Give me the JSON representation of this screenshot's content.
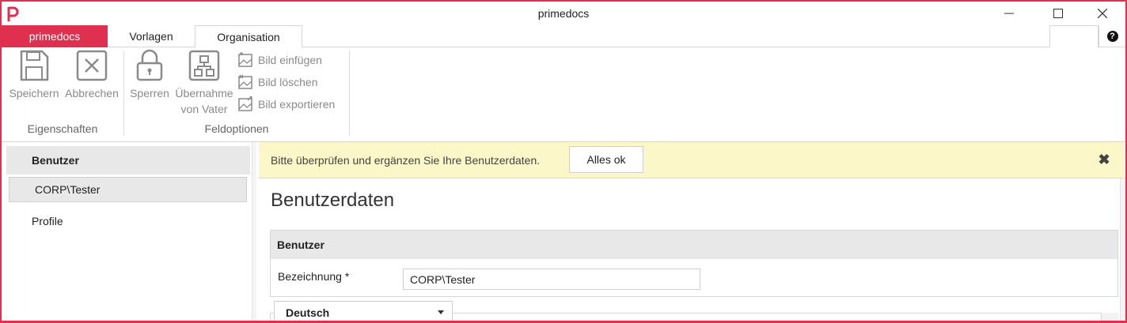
{
  "window": {
    "title": "primedocs",
    "brand_color": "#e0304f"
  },
  "tabs": [
    {
      "label": "primedocs",
      "active": false
    },
    {
      "label": "Vorlagen",
      "active": false
    },
    {
      "label": "Organisation",
      "active": true
    }
  ],
  "help": {
    "icon": "help-icon",
    "label": "?"
  },
  "ribbon": {
    "save_label": "Speichern",
    "cancel_label": "Abbrechen",
    "lock_label": "Sperren",
    "inherit_label_line1": "Übernahme",
    "inherit_label_line2": "von Vater",
    "insert_image_label": "Bild einfügen",
    "delete_image_label": "Bild löschen",
    "export_image_label": "Bild exportieren",
    "group_properties": "Eigenschaften",
    "group_field_options": "Feldoptionen"
  },
  "sidebar": {
    "header": "Benutzer",
    "selected_item": "CORP\\Tester",
    "items": [
      {
        "label": "Profile"
      }
    ]
  },
  "banner": {
    "message": "Bitte überprüfen und ergänzen Sie Ihre Benutzerdaten.",
    "button_label": "Alles ok",
    "close_icon": "close-icon",
    "background": "#fbf7c9"
  },
  "main": {
    "title": "Benutzerdaten",
    "section_title": "Benutzer",
    "field_label": "Bezeichnung *",
    "field_value": "CORP\\Tester",
    "language_value": "Deutsch"
  }
}
